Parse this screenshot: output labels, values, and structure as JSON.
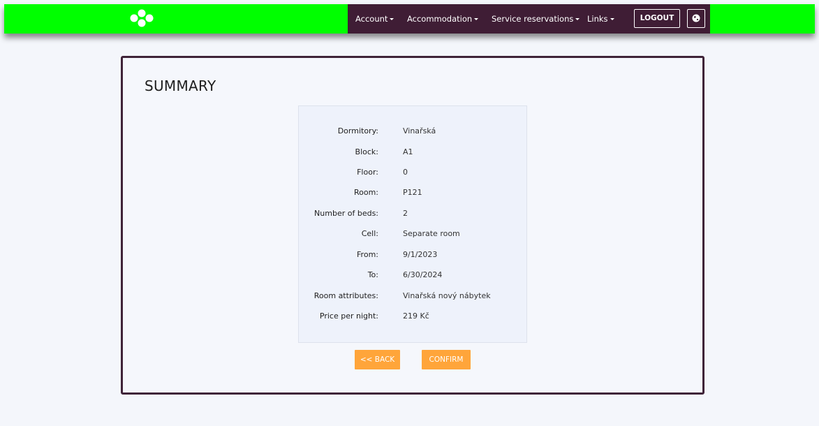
{
  "header": {
    "nav": [
      {
        "label": "Account"
      },
      {
        "label": "Accommodation"
      },
      {
        "label": "Service reservations"
      },
      {
        "label": "Links"
      }
    ],
    "logout_label": "LOGOUT"
  },
  "summary": {
    "title": "SUMMARY",
    "rows": [
      {
        "label": "Dormitory:",
        "value": "Vinařská"
      },
      {
        "label": "Block:",
        "value": "A1"
      },
      {
        "label": "Floor:",
        "value": "0"
      },
      {
        "label": "Room:",
        "value": "P121"
      },
      {
        "label": "Number of beds:",
        "value": "2"
      },
      {
        "label": "Cell:",
        "value": "Separate room"
      },
      {
        "label": "From:",
        "value": "9/1/2023"
      },
      {
        "label": "To:",
        "value": "6/30/2024"
      },
      {
        "label": "Room attributes:",
        "value": "Vinařská nový nábytek"
      },
      {
        "label": "Price per night:",
        "value": "219 Kč"
      }
    ],
    "back_label": "<< BACK",
    "confirm_label": "CONFIRM"
  },
  "colors": {
    "header_bg": "#00ff00",
    "nav_bg": "#3f1d35",
    "panel_border": "#3f2338",
    "button": "#ffa53a",
    "page_bg": "#f4f6fb"
  }
}
